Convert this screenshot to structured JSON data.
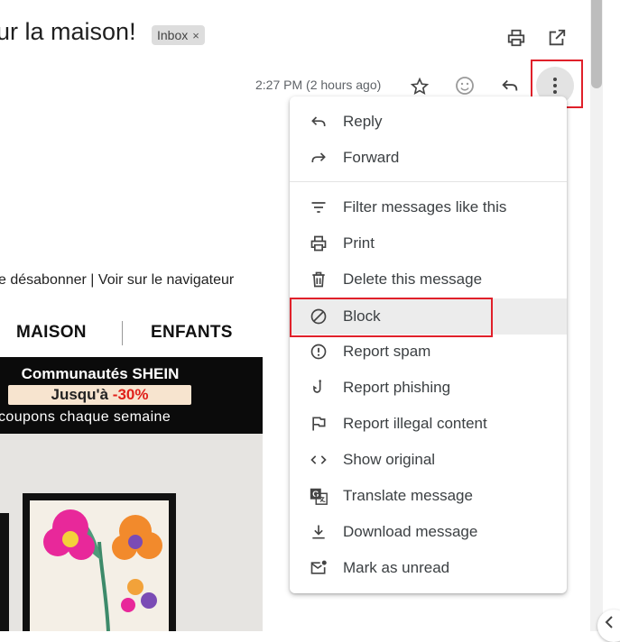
{
  "email": {
    "subject": "ur la maison!",
    "label_chip": "Inbox",
    "label_close": "×",
    "timestamp": "2:27 PM (2 hours ago)"
  },
  "content": {
    "links": "e désabonner | Voir sur le navigateur",
    "category_1": "MAISON",
    "category_2": "ENFANTS",
    "banner_title": "Communautés SHEIN",
    "banner_offer_prefix": "Jusqu'à ",
    "banner_offer_discount": "-30%",
    "banner_sub": "coupons chaque semaine"
  },
  "menu": {
    "items": [
      {
        "label": "Reply",
        "icon": "reply-icon"
      },
      {
        "label": "Forward",
        "icon": "forward-icon"
      },
      {
        "label": "Filter messages like this",
        "icon": "filter-icon"
      },
      {
        "label": "Print",
        "icon": "print-icon"
      },
      {
        "label": "Delete this message",
        "icon": "trash-icon"
      },
      {
        "label": "Block",
        "icon": "block-icon"
      },
      {
        "label": "Report spam",
        "icon": "report-spam-icon"
      },
      {
        "label": "Report phishing",
        "icon": "phishing-hook-icon"
      },
      {
        "label": "Report illegal content",
        "icon": "flag-icon"
      },
      {
        "label": "Show original",
        "icon": "code-icon"
      },
      {
        "label": "Translate message",
        "icon": "translate-icon"
      },
      {
        "label": "Download message",
        "icon": "download-icon"
      },
      {
        "label": "Mark as unread",
        "icon": "mark-unread-icon"
      }
    ]
  },
  "colors": {
    "highlight_box": "#e0202a",
    "menu_hover": "#ececec"
  }
}
